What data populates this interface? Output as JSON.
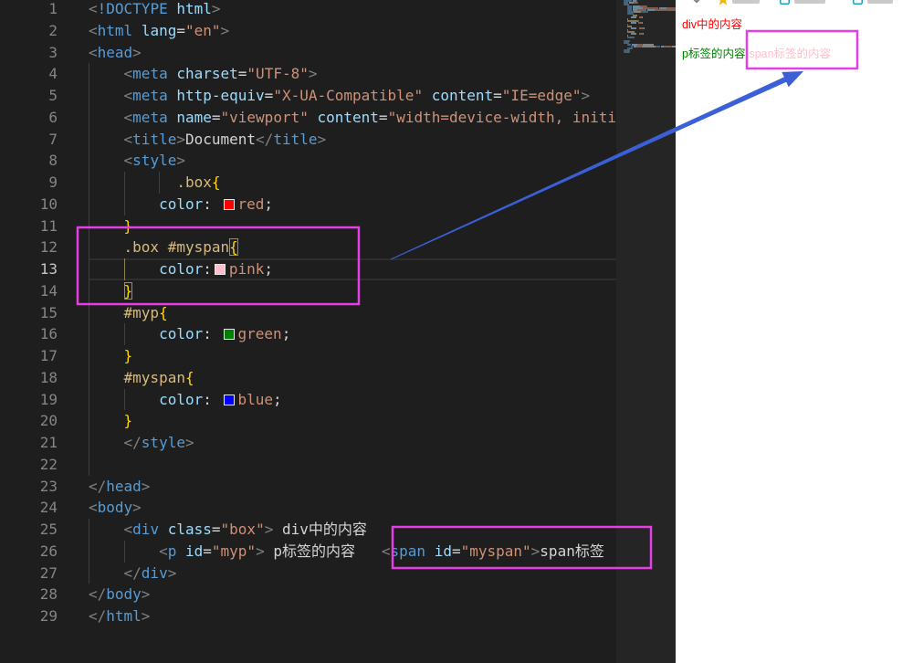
{
  "editor": {
    "lines": [
      {
        "n": "1",
        "tokens": [
          {
            "t": "<",
            "c": "br"
          },
          {
            "t": "!DOCTYPE",
            "c": "tag"
          },
          {
            "t": " ",
            "c": "text"
          },
          {
            "t": "html",
            "c": "attr"
          },
          {
            "t": ">",
            "c": "br"
          }
        ]
      },
      {
        "n": "2",
        "tokens": [
          {
            "t": "<",
            "c": "br"
          },
          {
            "t": "html",
            "c": "tag"
          },
          {
            "t": " ",
            "c": "text"
          },
          {
            "t": "lang",
            "c": "attr"
          },
          {
            "t": "=",
            "c": "eq"
          },
          {
            "t": "\"en\"",
            "c": "str"
          },
          {
            "t": ">",
            "c": "br"
          }
        ]
      },
      {
        "n": "3",
        "tokens": [
          {
            "t": "<",
            "c": "br"
          },
          {
            "t": "head",
            "c": "tag"
          },
          {
            "t": ">",
            "c": "br"
          }
        ]
      },
      {
        "n": "4",
        "tokens": [
          {
            "t": "    ",
            "c": "ws"
          },
          {
            "t": "<",
            "c": "br"
          },
          {
            "t": "meta",
            "c": "tag"
          },
          {
            "t": " ",
            "c": "text"
          },
          {
            "t": "charset",
            "c": "attr"
          },
          {
            "t": "=",
            "c": "eq"
          },
          {
            "t": "\"UTF-8\"",
            "c": "str"
          },
          {
            "t": ">",
            "c": "br"
          }
        ]
      },
      {
        "n": "5",
        "tokens": [
          {
            "t": "    ",
            "c": "ws"
          },
          {
            "t": "<",
            "c": "br"
          },
          {
            "t": "meta",
            "c": "tag"
          },
          {
            "t": " ",
            "c": "text"
          },
          {
            "t": "http-equiv",
            "c": "attr"
          },
          {
            "t": "=",
            "c": "eq"
          },
          {
            "t": "\"X-UA-Compatible\"",
            "c": "str"
          },
          {
            "t": " ",
            "c": "text"
          },
          {
            "t": "content",
            "c": "attr"
          },
          {
            "t": "=",
            "c": "eq"
          },
          {
            "t": "\"IE=edge\"",
            "c": "str"
          },
          {
            "t": ">",
            "c": "br"
          }
        ]
      },
      {
        "n": "6",
        "tokens": [
          {
            "t": "    ",
            "c": "ws"
          },
          {
            "t": "<",
            "c": "br"
          },
          {
            "t": "meta",
            "c": "tag"
          },
          {
            "t": " ",
            "c": "text"
          },
          {
            "t": "name",
            "c": "attr"
          },
          {
            "t": "=",
            "c": "eq"
          },
          {
            "t": "\"viewport\"",
            "c": "str"
          },
          {
            "t": " ",
            "c": "text"
          },
          {
            "t": "content",
            "c": "attr"
          },
          {
            "t": "=",
            "c": "eq"
          },
          {
            "t": "\"width=device-width, initi",
            "c": "str"
          }
        ]
      },
      {
        "n": "7",
        "tokens": [
          {
            "t": "    ",
            "c": "ws"
          },
          {
            "t": "<",
            "c": "br"
          },
          {
            "t": "title",
            "c": "tag"
          },
          {
            "t": ">",
            "c": "br"
          },
          {
            "t": "Document",
            "c": "text"
          },
          {
            "t": "</",
            "c": "br"
          },
          {
            "t": "title",
            "c": "tag"
          },
          {
            "t": ">",
            "c": "br"
          }
        ]
      },
      {
        "n": "8",
        "tokens": [
          {
            "t": "    ",
            "c": "ws"
          },
          {
            "t": "<",
            "c": "br"
          },
          {
            "t": "style",
            "c": "tag"
          },
          {
            "t": ">",
            "c": "br"
          }
        ]
      },
      {
        "n": "9",
        "tokens": [
          {
            "t": "          ",
            "c": "ws"
          },
          {
            "t": ".box",
            "c": "sel"
          },
          {
            "t": "{",
            "c": "brace"
          }
        ]
      },
      {
        "n": "10",
        "tokens": [
          {
            "t": "        ",
            "c": "ws"
          },
          {
            "t": "color",
            "c": "prop"
          },
          {
            "t": ":",
            "c": "punct"
          },
          {
            "t": " ",
            "c": "text"
          },
          {
            "swatch": "#ff0000"
          },
          {
            "t": "red",
            "c": "val"
          },
          {
            "t": ";",
            "c": "punct"
          }
        ]
      },
      {
        "n": "11",
        "tokens": [
          {
            "t": "    ",
            "c": "ws"
          },
          {
            "t": "}",
            "c": "brace"
          }
        ]
      },
      {
        "n": "12",
        "tokens": [
          {
            "t": "    ",
            "c": "ws"
          },
          {
            "t": ".box #myspan",
            "c": "sel"
          },
          {
            "t": "{",
            "c": "brace-match"
          }
        ]
      },
      {
        "n": "13",
        "active": true,
        "tokens": [
          {
            "t": "        ",
            "c": "ws"
          },
          {
            "t": "color",
            "c": "prop"
          },
          {
            "t": ":",
            "c": "punct"
          },
          {
            "swatch": "#ffc0cb"
          },
          {
            "t": "pink",
            "c": "val"
          },
          {
            "t": ";",
            "c": "punct"
          }
        ]
      },
      {
        "n": "14",
        "tokens": [
          {
            "t": "    ",
            "c": "ws"
          },
          {
            "t": "}",
            "c": "brace-match"
          }
        ]
      },
      {
        "n": "15",
        "tokens": [
          {
            "t": "    ",
            "c": "ws"
          },
          {
            "t": "#myp",
            "c": "sel"
          },
          {
            "t": "{",
            "c": "brace"
          }
        ]
      },
      {
        "n": "16",
        "tokens": [
          {
            "t": "        ",
            "c": "ws"
          },
          {
            "t": "color",
            "c": "prop"
          },
          {
            "t": ":",
            "c": "punct"
          },
          {
            "t": " ",
            "c": "text"
          },
          {
            "swatch": "#008000"
          },
          {
            "t": "green",
            "c": "val"
          },
          {
            "t": ";",
            "c": "punct"
          }
        ]
      },
      {
        "n": "17",
        "tokens": [
          {
            "t": "    ",
            "c": "ws"
          },
          {
            "t": "}",
            "c": "brace"
          }
        ]
      },
      {
        "n": "18",
        "tokens": [
          {
            "t": "    ",
            "c": "ws"
          },
          {
            "t": "#myspan",
            "c": "sel"
          },
          {
            "t": "{",
            "c": "brace"
          }
        ]
      },
      {
        "n": "19",
        "tokens": [
          {
            "t": "        ",
            "c": "ws"
          },
          {
            "t": "color",
            "c": "prop"
          },
          {
            "t": ":",
            "c": "punct"
          },
          {
            "t": " ",
            "c": "text"
          },
          {
            "swatch": "#0000ff"
          },
          {
            "t": "blue",
            "c": "val"
          },
          {
            "t": ";",
            "c": "punct"
          }
        ]
      },
      {
        "n": "20",
        "tokens": [
          {
            "t": "    ",
            "c": "ws"
          },
          {
            "t": "}",
            "c": "brace"
          }
        ]
      },
      {
        "n": "21",
        "tokens": [
          {
            "t": "    ",
            "c": "ws"
          },
          {
            "t": "</",
            "c": "br"
          },
          {
            "t": "style",
            "c": "tag"
          },
          {
            "t": ">",
            "c": "br"
          }
        ]
      },
      {
        "n": "22",
        "tokens": []
      },
      {
        "n": "23",
        "tokens": [
          {
            "t": "</",
            "c": "br"
          },
          {
            "t": "head",
            "c": "tag"
          },
          {
            "t": ">",
            "c": "br"
          }
        ]
      },
      {
        "n": "24",
        "tokens": [
          {
            "t": "<",
            "c": "br"
          },
          {
            "t": "body",
            "c": "tag"
          },
          {
            "t": ">",
            "c": "br"
          }
        ]
      },
      {
        "n": "25",
        "tokens": [
          {
            "t": "    ",
            "c": "ws"
          },
          {
            "t": "<",
            "c": "br"
          },
          {
            "t": "div",
            "c": "tag"
          },
          {
            "t": " ",
            "c": "text"
          },
          {
            "t": "class",
            "c": "attr"
          },
          {
            "t": "=",
            "c": "eq"
          },
          {
            "t": "\"box\"",
            "c": "str"
          },
          {
            "t": ">",
            "c": "br"
          },
          {
            "t": " div中的内容",
            "c": "text"
          }
        ]
      },
      {
        "n": "26",
        "tokens": [
          {
            "t": "        ",
            "c": "ws"
          },
          {
            "t": "<",
            "c": "br"
          },
          {
            "t": "p",
            "c": "tag"
          },
          {
            "t": " ",
            "c": "text"
          },
          {
            "t": "id",
            "c": "attr"
          },
          {
            "t": "=",
            "c": "eq"
          },
          {
            "t": "\"myp\"",
            "c": "str"
          },
          {
            "t": ">",
            "c": "br"
          },
          {
            "t": " p标签的内容   ",
            "c": "text"
          },
          {
            "t": "<",
            "c": "br"
          },
          {
            "t": "span",
            "c": "tag"
          },
          {
            "t": " ",
            "c": "text"
          },
          {
            "t": "id",
            "c": "attr"
          },
          {
            "t": "=",
            "c": "eq"
          },
          {
            "t": "\"myspan\"",
            "c": "str"
          },
          {
            "t": ">",
            "c": "br"
          },
          {
            "t": "span标签",
            "c": "text"
          }
        ]
      },
      {
        "n": "27",
        "tokens": [
          {
            "t": "    ",
            "c": "ws"
          },
          {
            "t": "</",
            "c": "br"
          },
          {
            "t": "div",
            "c": "tag"
          },
          {
            "t": ">",
            "c": "br"
          }
        ]
      },
      {
        "n": "28",
        "tokens": [
          {
            "t": "</",
            "c": "br"
          },
          {
            "t": "body",
            "c": "tag"
          },
          {
            "t": ">",
            "c": "br"
          }
        ]
      },
      {
        "n": "29",
        "tokens": [
          {
            "t": "</",
            "c": "br"
          },
          {
            "t": "html",
            "c": "tag"
          },
          {
            "t": ">",
            "c": "br"
          }
        ]
      }
    ]
  },
  "preview": {
    "div_text": "div中的内容",
    "p_text": "p标签的内容",
    "span_text": "span标签的内容",
    "div_color": "#ff0000",
    "p_color": "#008000",
    "span_color": "#ffc0cb"
  },
  "browser_toolbar": {
    "icons": [
      "download-icon",
      "star-icon",
      "bookmark-icon",
      "bookmark-icon"
    ]
  },
  "annotations": {
    "box_color": "#e63ee6",
    "arrow_color": "#3b5fd6"
  }
}
